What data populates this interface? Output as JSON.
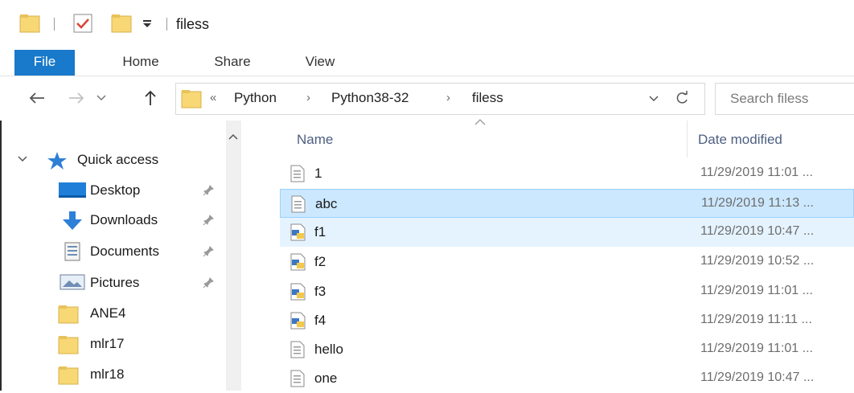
{
  "window": {
    "title": "filess"
  },
  "ribbon": {
    "tabs": [
      {
        "label": "File"
      },
      {
        "label": "Home"
      },
      {
        "label": "Share"
      },
      {
        "label": "View"
      }
    ]
  },
  "address": {
    "overflow": "«",
    "crumbs": [
      {
        "label": "Python"
      },
      {
        "label": "Python38-32"
      },
      {
        "label": "filess"
      }
    ],
    "separator": "›"
  },
  "search": {
    "placeholder": "Search filess"
  },
  "navpane": {
    "quick_access": "Quick access",
    "items": [
      {
        "label": "Desktop",
        "icon": "desktop-icon",
        "pinned": true
      },
      {
        "label": "Downloads",
        "icon": "download-arrow-icon",
        "pinned": true
      },
      {
        "label": "Documents",
        "icon": "documents-icon",
        "pinned": true
      },
      {
        "label": "Pictures",
        "icon": "pictures-icon",
        "pinned": true
      },
      {
        "label": "ANE4",
        "icon": "folder-icon",
        "pinned": false
      },
      {
        "label": "mlr17",
        "icon": "folder-icon",
        "pinned": false
      },
      {
        "label": "mlr18",
        "icon": "folder-icon",
        "pinned": false
      }
    ]
  },
  "filelist": {
    "columns": {
      "name": "Name",
      "date": "Date modified"
    },
    "rows": [
      {
        "name": "1",
        "date": "11/29/2019 11:01 ...",
        "type": "text",
        "state": "normal"
      },
      {
        "name": "abc",
        "date": "11/29/2019 11:13 ...",
        "type": "text",
        "state": "selected"
      },
      {
        "name": "f1",
        "date": "11/29/2019 10:47 ...",
        "type": "python",
        "state": "hover"
      },
      {
        "name": "f2",
        "date": "11/29/2019 10:52 ...",
        "type": "python",
        "state": "normal"
      },
      {
        "name": "f3",
        "date": "11/29/2019 11:01 ...",
        "type": "python",
        "state": "normal"
      },
      {
        "name": "f4",
        "date": "11/29/2019 11:11 ...",
        "type": "python",
        "state": "normal"
      },
      {
        "name": "hello",
        "date": "11/29/2019 11:01 ...",
        "type": "text",
        "state": "normal"
      },
      {
        "name": "one",
        "date": "11/29/2019 10:47 ...",
        "type": "text",
        "state": "normal"
      }
    ]
  },
  "colors": {
    "accent": "#1979ca",
    "selected_bg": "#cce8ff",
    "hover_bg": "#e5f3ff",
    "folder": "#f8d775"
  }
}
